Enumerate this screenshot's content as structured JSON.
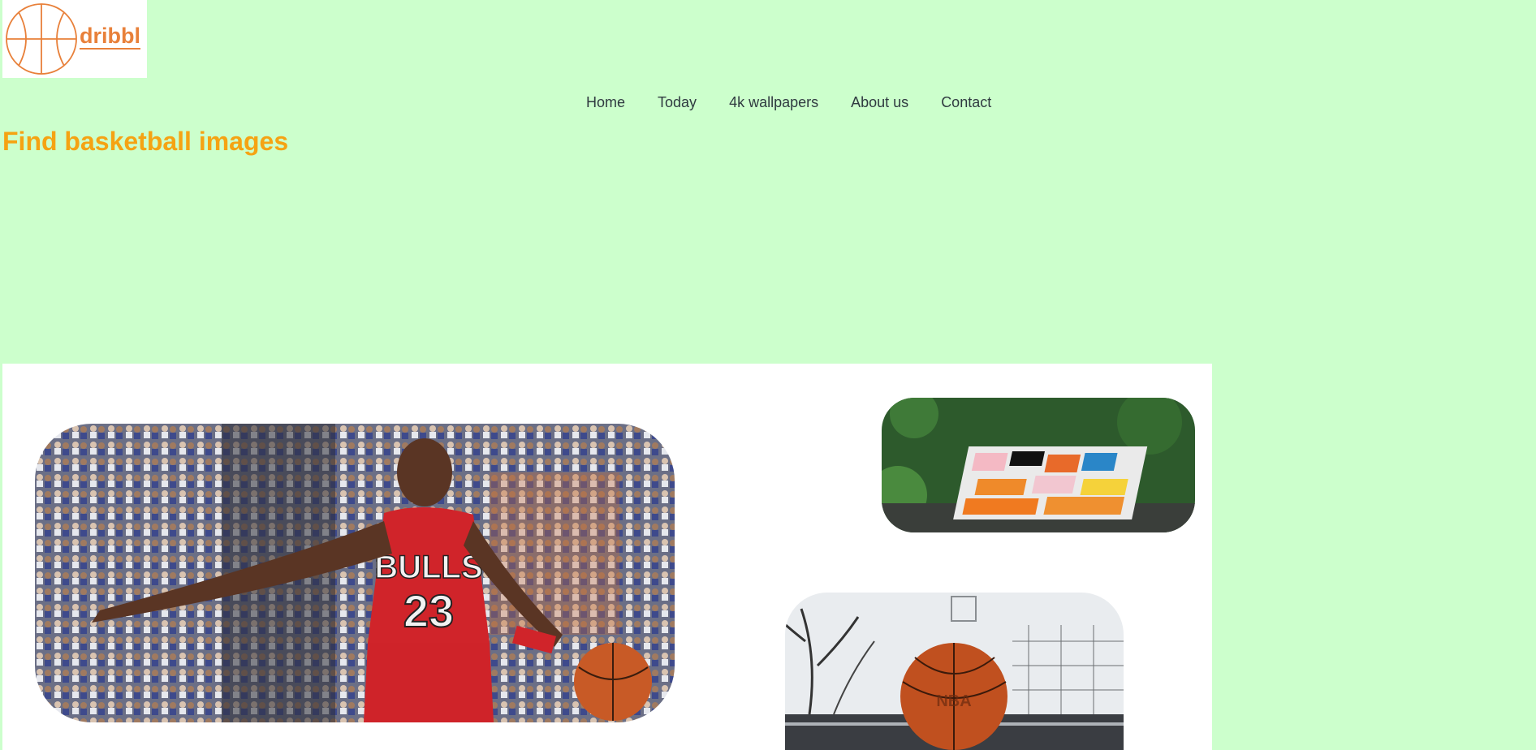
{
  "logo": {
    "text": "dribbl",
    "icon": "basketball-icon"
  },
  "nav": {
    "items": [
      {
        "label": "Home"
      },
      {
        "label": "Today"
      },
      {
        "label": "4k wallpapers"
      },
      {
        "label": "About us"
      },
      {
        "label": "Contact"
      }
    ]
  },
  "headline": "Find basketball images",
  "gallery": {
    "images": [
      {
        "subject": "basketball player in red jersey dribbling"
      },
      {
        "subject": "aerial view of colorful outdoor court"
      },
      {
        "subject": "basketball on wet outdoor court"
      }
    ]
  },
  "colors": {
    "page_bg": "#ccffcc",
    "accent_orange": "#e8803a",
    "headline": "#f5a313",
    "nav_text": "#2f3a40"
  }
}
